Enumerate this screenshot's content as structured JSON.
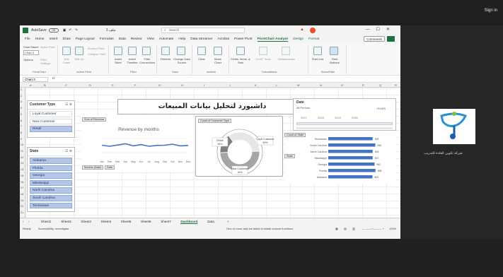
{
  "top": {
    "sign_in": "Sign in"
  },
  "titlebar": {
    "autosave": "AutoSave",
    "toggle": "Off",
    "doc": "1 ملف",
    "search": "Search"
  },
  "menu": [
    "File",
    "Home",
    "Insert",
    "Draw",
    "Page Layout",
    "Formulas",
    "Data",
    "Review",
    "View",
    "Automate",
    "Help",
    "Data Streamer",
    "Acrobat",
    "Power Pivot",
    "PivotChart Analyze",
    "Design",
    "Format"
  ],
  "menu_active": "PivotChart Analyze",
  "comments": "Comments",
  "ribbon": {
    "chart_name_label": "Chart Name",
    "chart_name_value": "Chart 3",
    "active_field": "Active Field",
    "options": "Options",
    "field_settings": "Field Settings",
    "drill_down": "Drill Down",
    "drill_up": "Drill Up",
    "expand_field": "Expand Field",
    "collapse_field": "Collapse Field",
    "insert_slicer": "Insert Slicer",
    "insert_timeline": "Insert Timeline",
    "filter_connections": "Filter Connections",
    "refresh": "Refresh",
    "change_data_source": "Change Data Source",
    "clear": "Clear",
    "move_chart": "Move Chart",
    "fields_items_sets": "Fields, Items, & Sets",
    "olap_tools": "OLAP Tools",
    "relationships": "Relationships",
    "field_list": "Field List",
    "field_buttons": "Field Buttons",
    "groups": {
      "pivotchart": "PivotChart",
      "active_field": "Active Field",
      "filter": "Filter",
      "data": "Data",
      "actions": "Actions",
      "calculations": "Calculations",
      "show_hide": "Show/Hide"
    }
  },
  "formula_bar": {
    "name_box": "Chart 3",
    "fx": "fx"
  },
  "columns": [
    "A",
    "B",
    "C",
    "D",
    "E",
    "F",
    "G",
    "H",
    "I",
    "J",
    "K",
    "L",
    "M",
    "N",
    "O",
    "P",
    "Q",
    "R"
  ],
  "rows": [
    "1",
    "2",
    "3",
    "4",
    "5",
    "6",
    "7",
    "8",
    "9",
    "10",
    "11",
    "12",
    "13",
    "14",
    "15",
    "16",
    "17",
    "18",
    "19",
    "20",
    "21"
  ],
  "slicer_customer": {
    "title": "Customer Type",
    "items": [
      {
        "label": "Loyal Customer",
        "selected": false
      },
      {
        "label": "New Customer",
        "selected": false
      },
      {
        "label": "Retail",
        "selected": true
      }
    ]
  },
  "slicer_state": {
    "title": "State",
    "items": [
      {
        "label": "Alabama"
      },
      {
        "label": "Florida"
      },
      {
        "label": "Georgia"
      },
      {
        "label": "Mississippi"
      },
      {
        "label": "North Carolina"
      },
      {
        "label": "South Carolina"
      },
      {
        "label": "Tennessee"
      }
    ]
  },
  "dashboard_title": "داشبورد لتحليل بيانات المبيعات",
  "timeline": {
    "title": "Date",
    "subtitle": "All Periods",
    "unit": "YEARS",
    "years": [
      "2017",
      "2018",
      "2019",
      "2020"
    ]
  },
  "line_chart": {
    "field_btn": "Sum of Revenue",
    "title": "Revenue by months",
    "months": [
      "Jan",
      "Feb",
      "Mar",
      "Apr",
      "May",
      "Jun",
      "Jul",
      "Aug",
      "Sep",
      "Oct",
      "Nov",
      "Dec"
    ],
    "axis_btn1": "Months (Date)",
    "axis_btn2": "Date"
  },
  "donut_chart": {
    "field_btn": "Count of Customer Type",
    "labels": [
      {
        "name": "Retail",
        "pct": "34%"
      },
      {
        "name": "Loyal Customer",
        "pct": "50%"
      },
      {
        "name": "New Customer",
        "pct": "16%"
      }
    ]
  },
  "bar_chart": {
    "field_btn": "Count of State",
    "axis_btn": "State",
    "states": [
      "Tennessee",
      "South Carolina",
      "North Carolina",
      "Mississippi",
      "Georgia",
      "Florida",
      "Alabama"
    ],
    "values": [
      806,
      855,
      806,
      807,
      842,
      858,
      803
    ]
  },
  "sheets": [
    "Sheet1",
    "Sheet2",
    "Sheet3",
    "Sheet4",
    "Sheet5",
    "Sheet6",
    "Sheet7",
    "Dashboard",
    "Data"
  ],
  "active_sheet": "Dashboard",
  "status": {
    "ready": "Ready",
    "accessibility": "Accessibility: Investigate",
    "addin": "One or more add-ins failed to install custom functions.",
    "zoom": "100%"
  },
  "right_panel": {
    "caption": "شركة تكوين القادة للتدريب"
  },
  "colors": {
    "excel_green": "#1d6f42",
    "slicer_selected": "#b4c6e7",
    "line": "#4472c4",
    "bar": "#4472c4"
  }
}
